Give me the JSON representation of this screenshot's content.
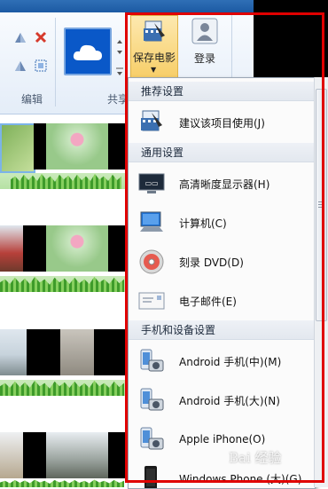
{
  "ribbon": {
    "group_edit_label": "编辑",
    "group_share_label": "共享",
    "save_movie_label": "保存电影",
    "login_label": "登录"
  },
  "menu": {
    "sections": [
      {
        "title": "推荐设置",
        "items": [
          {
            "label": "建议该项目使用(J)",
            "icon": "recommend-icon"
          }
        ]
      },
      {
        "title": "通用设置",
        "items": [
          {
            "label": "高清晰度显示器(H)",
            "icon": "hd-display-icon"
          },
          {
            "label": "计算机(C)",
            "icon": "computer-icon"
          },
          {
            "label": "刻录 DVD(D)",
            "icon": "dvd-icon"
          },
          {
            "label": "电子邮件(E)",
            "icon": "email-icon"
          }
        ]
      },
      {
        "title": "手机和设备设置",
        "items": [
          {
            "label": "Android 手机(中)(M)",
            "icon": "android-phone-icon"
          },
          {
            "label": "Android 手机(大)(N)",
            "icon": "android-phone-icon"
          },
          {
            "label": "Apple iPhone(O)",
            "icon": "iphone-icon"
          },
          {
            "label": "Windows Phone (大)(G)",
            "icon": "windows-phone-icon"
          }
        ]
      }
    ]
  },
  "watermark": "Bai 经验",
  "colors": {
    "highlight": "#e00000",
    "accent": "#0a58c8"
  }
}
